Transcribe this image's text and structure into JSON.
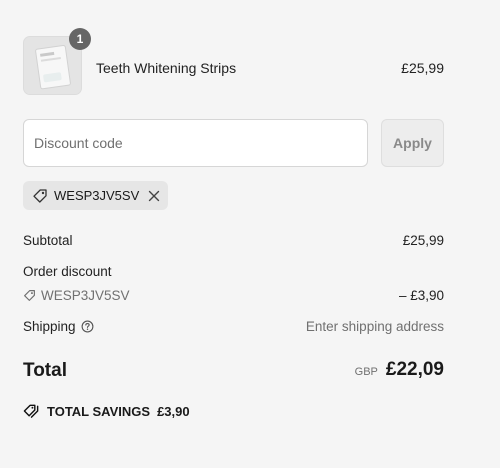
{
  "product": {
    "quantity": "1",
    "name": "Teeth Whitening Strips",
    "price": "£25,99"
  },
  "discount": {
    "placeholder": "Discount code",
    "apply_label": "Apply",
    "applied_code": "WESP3JV5SV"
  },
  "summary": {
    "subtotal_label": "Subtotal",
    "subtotal_value": "£25,99",
    "order_discount_label": "Order discount",
    "discount_code": "WESP3JV5SV",
    "discount_value": "– £3,90",
    "shipping_label": "Shipping",
    "shipping_value": "Enter shipping address",
    "total_label": "Total",
    "currency": "GBP",
    "total_value": "£22,09",
    "savings_label": "TOTAL SAVINGS",
    "savings_value": "£3,90"
  }
}
